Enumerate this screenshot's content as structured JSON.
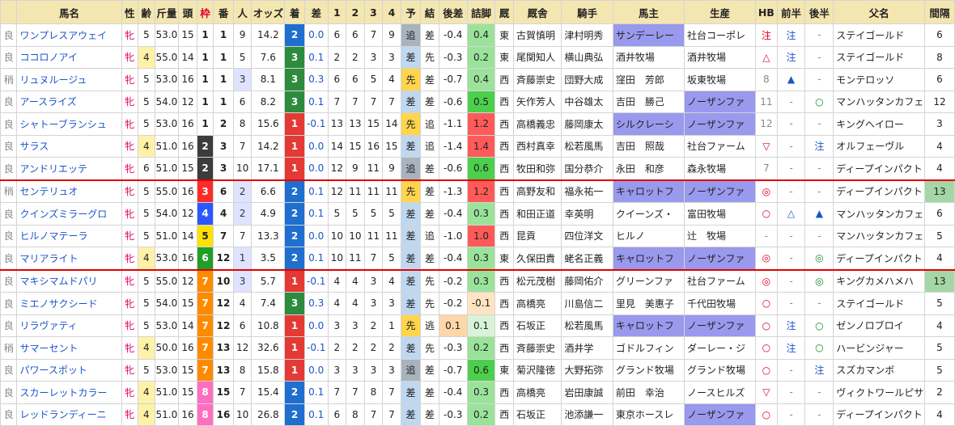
{
  "headers": [
    "馬名",
    "性",
    "齢",
    "斤量",
    "頭",
    "枠",
    "番",
    "人",
    "オッズ",
    "着",
    "差",
    "1",
    "2",
    "3",
    "4",
    "予",
    "結",
    "後差",
    "詰脚",
    "厩",
    "厩舎",
    "騎手",
    "馬主",
    "生産",
    "HB",
    "前半",
    "後半",
    "父名",
    "間隔"
  ],
  "frame_colors": {
    "1": "#ffffff",
    "2": "#3c3c3c",
    "3": "#ff2b2b",
    "4": "#2a57ff",
    "5": "#ffe100",
    "6": "#1f9e2a",
    "7": "#ff8a00",
    "8": "#ff6fc0"
  },
  "rows": [
    {
      "baba": "良",
      "name": "ワンプレスアウェイ",
      "sex": "牝",
      "age": "5",
      "kin": "53.0",
      "tou": "15",
      "waku": "1",
      "ban": "1",
      "ninki": "9",
      "odds": "14.2",
      "chaku": "2",
      "sa": "0.0",
      "c1": "6",
      "c2": "6",
      "c3": "7",
      "c4": "9",
      "yo": "追",
      "ketsu": "差",
      "atosa": "-0.4",
      "tsume": "0.4",
      "umaya": "東",
      "kyusha": "古賀慎明",
      "kishu": "津村明秀",
      "banushi": "サンデーレー",
      "seisan": "社台コーポレ",
      "hb": "注",
      "zenhan": "注",
      "kohan": "-",
      "chichi": "ステイゴールド",
      "kankaku": "6"
    },
    {
      "baba": "良",
      "name": "ココロノアイ",
      "sex": "牝",
      "age": "4",
      "kin": "55.0",
      "tou": "14",
      "waku": "1",
      "ban": "1",
      "ninki": "5",
      "odds": "7.6",
      "chaku": "3",
      "sa": "0.1",
      "c1": "2",
      "c2": "2",
      "c3": "3",
      "c4": "3",
      "yo": "差",
      "ketsu": "先",
      "atosa": "-0.3",
      "tsume": "0.2",
      "umaya": "東",
      "kyusha": "尾関知人",
      "kishu": "横山典弘",
      "banushi": "酒井牧場",
      "seisan": "酒井牧場",
      "hb": "△",
      "zenhan": "注",
      "kohan": "-",
      "chichi": "ステイゴールド",
      "kankaku": "8"
    },
    {
      "baba": "稍",
      "name": "リュヌルージュ",
      "sex": "牝",
      "age": "5",
      "kin": "53.0",
      "tou": "16",
      "waku": "1",
      "ban": "1",
      "ninki": "3",
      "odds": "8.1",
      "chaku": "3",
      "sa": "0.3",
      "c1": "6",
      "c2": "6",
      "c3": "5",
      "c4": "4",
      "yo": "先",
      "ketsu": "差",
      "atosa": "-0.7",
      "tsume": "0.4",
      "umaya": "西",
      "kyusha": "斉藤崇史",
      "kishu": "団野大成",
      "banushi": "窪田　芳郎",
      "seisan": "坂東牧場",
      "hb": "8",
      "zenhan": "▲",
      "kohan": "-",
      "chichi": "モンテロッソ",
      "kankaku": "6"
    },
    {
      "baba": "良",
      "name": "アースライズ",
      "sex": "牝",
      "age": "5",
      "kin": "54.0",
      "tou": "12",
      "waku": "1",
      "ban": "1",
      "ninki": "6",
      "odds": "8.2",
      "chaku": "3",
      "sa": "0.1",
      "c1": "7",
      "c2": "7",
      "c3": "7",
      "c4": "7",
      "yo": "差",
      "ketsu": "差",
      "atosa": "-0.6",
      "tsume": "0.5",
      "umaya": "西",
      "kyusha": "矢作芳人",
      "kishu": "中谷雄太",
      "banushi": "吉田　勝己",
      "seisan": "ノーザンファ",
      "hb": "11",
      "zenhan": "-",
      "kohan": "○",
      "chichi": "マンハッタンカフェ",
      "kankaku": "12"
    },
    {
      "baba": "良",
      "name": "シャトーブランシュ",
      "sex": "牝",
      "age": "5",
      "kin": "53.0",
      "tou": "16",
      "waku": "1",
      "ban": "2",
      "ninki": "8",
      "odds": "15.6",
      "chaku": "1",
      "sa": "-0.1",
      "c1": "13",
      "c2": "13",
      "c3": "15",
      "c4": "14",
      "yo": "先",
      "ketsu": "追",
      "atosa": "-1.1",
      "tsume": "1.2",
      "umaya": "西",
      "kyusha": "高橋義忠",
      "kishu": "藤岡康太",
      "banushi": "シルクレーシ",
      "seisan": "ノーザンファ",
      "hb": "12",
      "zenhan": "-",
      "kohan": "-",
      "chichi": "キングヘイロー",
      "kankaku": "3"
    },
    {
      "baba": "良",
      "name": "サラス",
      "sex": "牝",
      "age": "4",
      "kin": "51.0",
      "tou": "16",
      "waku": "2",
      "ban": "3",
      "ninki": "7",
      "odds": "14.2",
      "chaku": "1",
      "sa": "0.0",
      "c1": "14",
      "c2": "15",
      "c3": "16",
      "c4": "15",
      "yo": "差",
      "ketsu": "追",
      "atosa": "-1.4",
      "tsume": "1.4",
      "umaya": "西",
      "kyusha": "西村真幸",
      "kishu": "松若風馬",
      "banushi": "吉田　照哉",
      "seisan": "社台ファーム",
      "hb": "▽",
      "zenhan": "-",
      "kohan": "注",
      "chichi": "オルフェーヴル",
      "kankaku": "4"
    },
    {
      "baba": "良",
      "name": "アンドリエッテ",
      "sex": "牝",
      "age": "6",
      "kin": "51.0",
      "tou": "15",
      "waku": "2",
      "ban": "3",
      "ninki": "10",
      "odds": "17.1",
      "chaku": "1",
      "sa": "0.0",
      "c1": "12",
      "c2": "9",
      "c3": "11",
      "c4": "9",
      "yo": "追",
      "ketsu": "差",
      "atosa": "-0.6",
      "tsume": "0.6",
      "umaya": "西",
      "kyusha": "牧田和弥",
      "kishu": "国分恭介",
      "banushi": "永田　和彦",
      "seisan": "森永牧場",
      "hb": "7",
      "zenhan": "-",
      "kohan": "-",
      "chichi": "ディープインパクト",
      "kankaku": "4",
      "sep": true
    },
    {
      "baba": "稍",
      "name": "センテリュオ",
      "sex": "牝",
      "age": "5",
      "kin": "55.0",
      "tou": "16",
      "waku": "3",
      "ban": "6",
      "ninki": "2",
      "odds": "6.6",
      "chaku": "2",
      "sa": "0.1",
      "c1": "12",
      "c2": "11",
      "c3": "11",
      "c4": "11",
      "yo": "先",
      "ketsu": "差",
      "atosa": "-1.3",
      "tsume": "1.2",
      "umaya": "西",
      "kyusha": "高野友和",
      "kishu": "福永祐一",
      "banushi": "キャロットフ",
      "seisan": "ノーザンファ",
      "hb": "◎",
      "zenhan": "-",
      "kohan": "-",
      "chichi": "ディープインパクト",
      "kankaku": "13"
    },
    {
      "baba": "良",
      "name": "クインズミラーグロ",
      "sex": "牝",
      "age": "5",
      "kin": "54.0",
      "tou": "12",
      "waku": "4",
      "ban": "4",
      "ninki": "2",
      "odds": "4.9",
      "chaku": "2",
      "sa": "0.1",
      "c1": "5",
      "c2": "5",
      "c3": "5",
      "c4": "5",
      "yo": "差",
      "ketsu": "差",
      "atosa": "-0.4",
      "tsume": "0.3",
      "umaya": "西",
      "kyusha": "和田正道",
      "kishu": "幸英明",
      "banushi": "クイーンズ・",
      "seisan": "富田牧場",
      "hb": "○",
      "zenhan": "△",
      "kohan": "▲",
      "chichi": "マンハッタンカフェ",
      "kankaku": "6"
    },
    {
      "baba": "良",
      "name": "ヒルノマテーラ",
      "sex": "牝",
      "age": "5",
      "kin": "51.0",
      "tou": "14",
      "waku": "5",
      "ban": "7",
      "ninki": "7",
      "odds": "13.3",
      "chaku": "2",
      "sa": "0.0",
      "c1": "10",
      "c2": "10",
      "c3": "11",
      "c4": "11",
      "yo": "差",
      "ketsu": "追",
      "atosa": "-1.0",
      "tsume": "1.0",
      "umaya": "西",
      "kyusha": "昆貢",
      "kishu": "四位洋文",
      "banushi": "ヒルノ",
      "seisan": "辻　牧場",
      "hb": "-",
      "zenhan": "-",
      "kohan": "-",
      "chichi": "マンハッタンカフェ",
      "kankaku": "5"
    },
    {
      "baba": "良",
      "name": "マリアライト",
      "sex": "牝",
      "age": "4",
      "kin": "53.0",
      "tou": "16",
      "waku": "6",
      "ban": "12",
      "ninki": "1",
      "odds": "3.5",
      "chaku": "2",
      "sa": "0.1",
      "c1": "10",
      "c2": "11",
      "c3": "7",
      "c4": "5",
      "yo": "差",
      "ketsu": "差",
      "atosa": "-0.4",
      "tsume": "0.3",
      "umaya": "東",
      "kyusha": "久保田貴",
      "kishu": "蛯名正義",
      "banushi": "キャロットフ",
      "seisan": "ノーザンファ",
      "hb": "◎",
      "zenhan": "-",
      "kohan": "◎",
      "chichi": "ディープインパクト",
      "kankaku": "4",
      "sep": true
    },
    {
      "baba": "良",
      "name": "マキシマムドパリ",
      "sex": "牝",
      "age": "5",
      "kin": "55.0",
      "tou": "12",
      "waku": "7",
      "ban": "10",
      "ninki": "3",
      "odds": "5.7",
      "chaku": "1",
      "sa": "-0.1",
      "c1": "4",
      "c2": "4",
      "c3": "3",
      "c4": "4",
      "yo": "差",
      "ketsu": "先",
      "atosa": "-0.2",
      "tsume": "0.3",
      "umaya": "西",
      "kyusha": "松元茂樹",
      "kishu": "藤岡佑介",
      "banushi": "グリーンファ",
      "seisan": "社台ファーム",
      "hb": "◎",
      "zenhan": "-",
      "kohan": "◎",
      "chichi": "キングカメハメハ",
      "kankaku": "13"
    },
    {
      "baba": "良",
      "name": "ミエノサクシード",
      "sex": "牝",
      "age": "5",
      "kin": "54.0",
      "tou": "15",
      "waku": "7",
      "ban": "12",
      "ninki": "4",
      "odds": "7.4",
      "chaku": "3",
      "sa": "0.3",
      "c1": "4",
      "c2": "4",
      "c3": "3",
      "c4": "3",
      "yo": "差",
      "ketsu": "先",
      "atosa": "-0.2",
      "tsume": "-0.1",
      "umaya": "西",
      "kyusha": "高橋亮",
      "kishu": "川島信二",
      "banushi": "里見　美惠子",
      "seisan": "千代田牧場",
      "hb": "○",
      "zenhan": "-",
      "kohan": "-",
      "chichi": "ステイゴールド",
      "kankaku": "5"
    },
    {
      "baba": "良",
      "name": "リラヴァティ",
      "sex": "牝",
      "age": "5",
      "kin": "53.0",
      "tou": "14",
      "waku": "7",
      "ban": "12",
      "ninki": "6",
      "odds": "10.8",
      "chaku": "1",
      "sa": "0.0",
      "c1": "3",
      "c2": "3",
      "c3": "2",
      "c4": "1",
      "yo": "先",
      "ketsu": "逃",
      "atosa": "0.1",
      "tsume": "0.1",
      "umaya": "西",
      "kyusha": "石坂正",
      "kishu": "松若風馬",
      "banushi": "キャロットフ",
      "seisan": "ノーザンファ",
      "hb": "○",
      "zenhan": "注",
      "kohan": "○",
      "chichi": "ゼンノロブロイ",
      "kankaku": "4"
    },
    {
      "baba": "稍",
      "name": "サマーセント",
      "sex": "牝",
      "age": "4",
      "kin": "50.0",
      "tou": "16",
      "waku": "7",
      "ban": "13",
      "ninki": "12",
      "odds": "32.6",
      "chaku": "1",
      "sa": "-0.1",
      "c1": "2",
      "c2": "2",
      "c3": "2",
      "c4": "2",
      "yo": "差",
      "ketsu": "先",
      "atosa": "-0.3",
      "tsume": "0.2",
      "umaya": "西",
      "kyusha": "斉藤崇史",
      "kishu": "酒井学",
      "banushi": "ゴドルフィン",
      "seisan": "ダーレー・ジ",
      "hb": "○",
      "zenhan": "注",
      "kohan": "○",
      "chichi": "ハービンジャー",
      "kankaku": "5"
    },
    {
      "baba": "良",
      "name": "パワースポット",
      "sex": "牝",
      "age": "5",
      "kin": "53.0",
      "tou": "15",
      "waku": "7",
      "ban": "13",
      "ninki": "8",
      "odds": "15.8",
      "chaku": "1",
      "sa": "0.0",
      "c1": "3",
      "c2": "3",
      "c3": "3",
      "c4": "3",
      "yo": "追",
      "ketsu": "差",
      "atosa": "-0.7",
      "tsume": "0.6",
      "umaya": "東",
      "kyusha": "菊沢隆徳",
      "kishu": "大野拓弥",
      "banushi": "グランド牧場",
      "seisan": "グランド牧場",
      "hb": "○",
      "zenhan": "-",
      "kohan": "注",
      "chichi": "スズカマンボ",
      "kankaku": "5"
    },
    {
      "baba": "良",
      "name": "スカーレットカラー",
      "sex": "牝",
      "age": "4",
      "kin": "51.0",
      "tou": "15",
      "waku": "8",
      "ban": "15",
      "ninki": "7",
      "odds": "15.4",
      "chaku": "2",
      "sa": "0.1",
      "c1": "7",
      "c2": "7",
      "c3": "8",
      "c4": "7",
      "yo": "差",
      "ketsu": "差",
      "atosa": "-0.4",
      "tsume": "0.3",
      "umaya": "西",
      "kyusha": "高橋亮",
      "kishu": "岩田康誠",
      "banushi": "前田　幸治",
      "seisan": "ノースヒルズ",
      "hb": "▽",
      "zenhan": "-",
      "kohan": "-",
      "chichi": "ヴィクトワールピサ",
      "kankaku": "2"
    },
    {
      "baba": "良",
      "name": "レッドランディーニ",
      "sex": "牝",
      "age": "4",
      "kin": "51.0",
      "tou": "16",
      "waku": "8",
      "ban": "16",
      "ninki": "10",
      "odds": "26.8",
      "chaku": "2",
      "sa": "0.1",
      "c1": "6",
      "c2": "8",
      "c3": "7",
      "c4": "7",
      "yo": "差",
      "ketsu": "差",
      "atosa": "-0.3",
      "tsume": "0.2",
      "umaya": "西",
      "kyusha": "石坂正",
      "kishu": "池添謙一",
      "banushi": "東京ホースレ",
      "seisan": "ノーザンファ",
      "hb": "○",
      "zenhan": "-",
      "kohan": "-",
      "chichi": "ディープインパクト",
      "kankaku": "4"
    }
  ]
}
